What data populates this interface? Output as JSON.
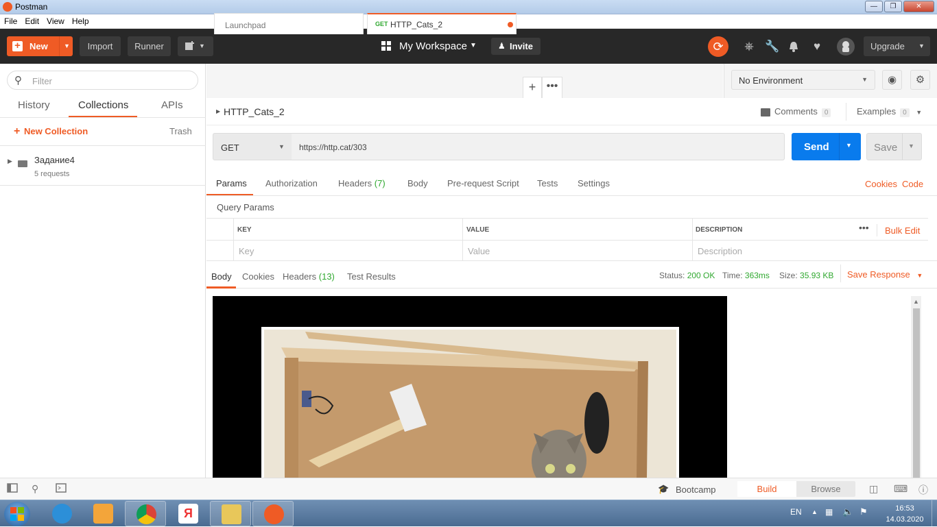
{
  "window": {
    "title": "Postman",
    "controls": [
      "minimize",
      "maximize",
      "close"
    ]
  },
  "menubar": [
    "File",
    "Edit",
    "View",
    "Help"
  ],
  "header": {
    "new_label": "New",
    "import_label": "Import",
    "runner_label": "Runner",
    "workspace_label": "My Workspace",
    "invite_label": "Invite",
    "upgrade_label": "Upgrade",
    "accent": "#ef5b25"
  },
  "sidebar": {
    "filter_placeholder": "Filter",
    "tabs": [
      "History",
      "Collections",
      "APIs"
    ],
    "active_tab": "Collections",
    "new_collection_label": "New Collection",
    "trash_label": "Trash",
    "collections": [
      {
        "name": "Задание4",
        "subtitle": "5 requests"
      }
    ]
  },
  "request_tabs": {
    "tabs": [
      {
        "label": "Launchpad"
      },
      {
        "method": "GET",
        "label": "HTTP_Cats_2",
        "unsaved": true
      }
    ]
  },
  "environment": {
    "selected": "No Environment"
  },
  "request": {
    "name": "HTTP_Cats_2",
    "comments_label": "Comments",
    "comments_count": "0",
    "examples_label": "Examples",
    "examples_count": "0",
    "method": "GET",
    "url": "https://http.cat/303",
    "send_label": "Send",
    "save_label": "Save",
    "tabs": [
      "Params",
      "Authorization",
      "Headers",
      "Body",
      "Pre-request Script",
      "Tests",
      "Settings"
    ],
    "headers_count": "(7)",
    "cookies_label": "Cookies",
    "code_label": "Code",
    "query_params_title": "Query Params",
    "columns": [
      "KEY",
      "VALUE",
      "DESCRIPTION"
    ],
    "bulk_edit_label": "Bulk Edit",
    "placeholders": {
      "key": "Key",
      "value": "Value",
      "description": "Description"
    }
  },
  "response": {
    "tabs": [
      "Body",
      "Cookies",
      "Headers",
      "Test Results"
    ],
    "headers_count": "(13)",
    "status_label": "Status:",
    "status_value": "200 OK",
    "time_label": "Time:",
    "time_value": "363ms",
    "size_label": "Size:",
    "size_value": "35.93 KB",
    "save_response_label": "Save Response"
  },
  "statusbar": {
    "bootcamp_label": "Bootcamp",
    "build_label": "Build",
    "browse_label": "Browse"
  },
  "taskbar": {
    "apps": [
      "internet-explorer",
      "media-player",
      "chrome",
      "yandex",
      "file-explorer",
      "postman"
    ],
    "language": "EN",
    "time": "16:53",
    "date": "14.03.2020"
  }
}
